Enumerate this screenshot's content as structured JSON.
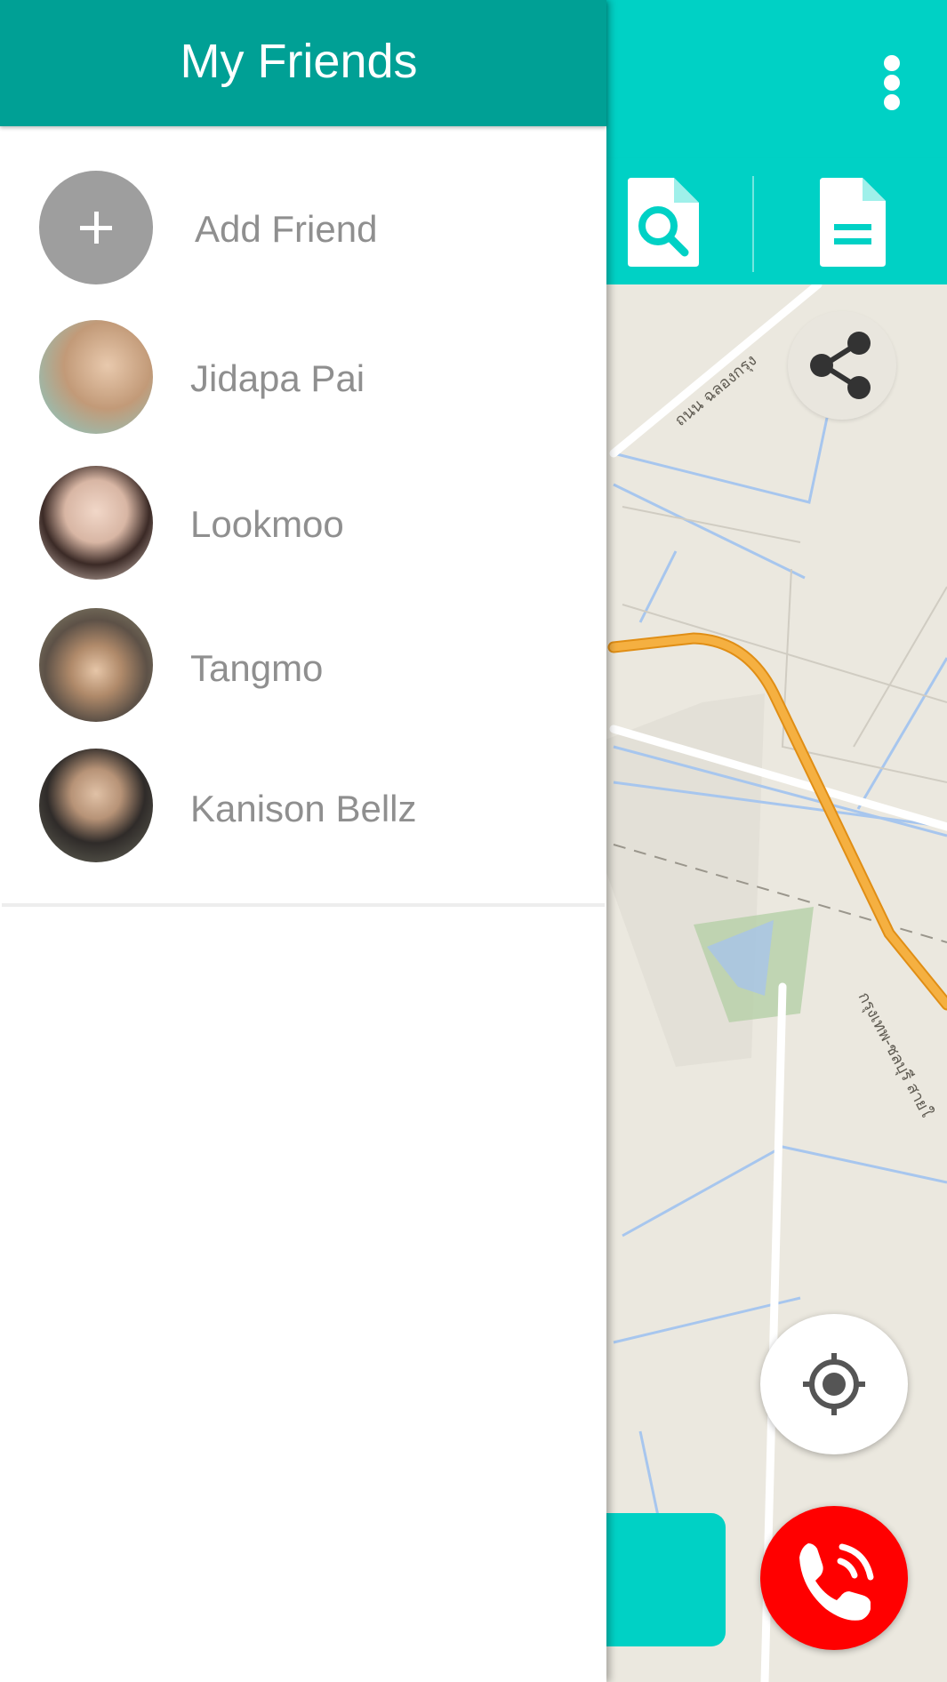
{
  "colors": {
    "accent": "#00d1c5",
    "drawer_header": "#00a095",
    "call": "#ff0000",
    "route": "#f2a22c",
    "friend_name_text": "#8f8f8f"
  },
  "appbar": {
    "overflow_icon": "more-vert-icon"
  },
  "toolbar": {
    "buttons": [
      {
        "icon": "search-document-icon"
      },
      {
        "icon": "document-icon"
      }
    ]
  },
  "map": {
    "road_labels": [
      "ถนน ฉลองกรุง",
      "กรุงเทพ-ชลบุรี สายใ"
    ]
  },
  "drawer": {
    "title": "My Friends",
    "add_friend": {
      "label": "Add Friend",
      "icon": "plus-icon"
    },
    "friends": [
      {
        "name": "Jidapa Pai",
        "avatar_color": "#c9a58a"
      },
      {
        "name": "Lookmoo",
        "avatar_color": "#d9c2b8"
      },
      {
        "name": "Tangmo",
        "avatar_color": "#6b5a4a"
      },
      {
        "name": "Kanison Bellz",
        "avatar_color": "#3d3a36"
      }
    ]
  },
  "floating_buttons": {
    "share_icon": "share-icon",
    "locate_icon": "my-location-icon",
    "call_icon": "phone-call-icon"
  }
}
